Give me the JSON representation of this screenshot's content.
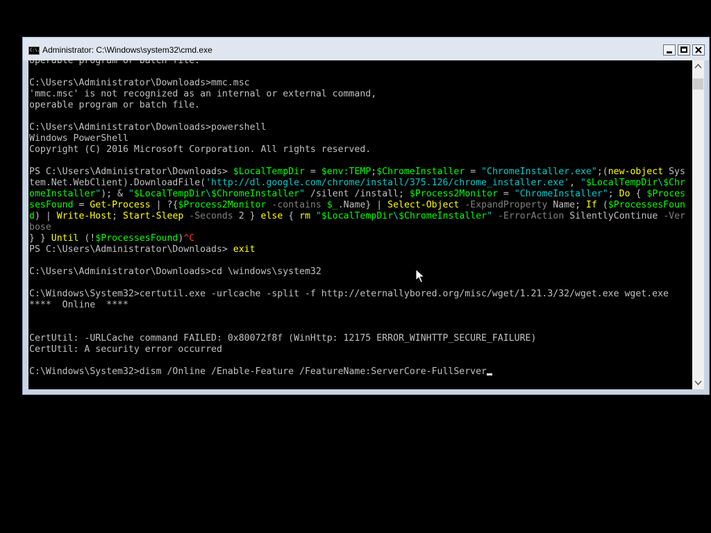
{
  "window": {
    "title": "Administrator: C:\\Windows\\system32\\cmd.exe",
    "icon_text": "C:\\."
  },
  "console": {
    "lines": [
      [
        {
          "t": "operable program or batch file.",
          "c": "default"
        }
      ],
      [],
      [
        {
          "t": "C:\\Users\\Administrator\\Downloads>mmc.msc",
          "c": "default"
        }
      ],
      [
        {
          "t": "'mmc.msc' is not recognized as an internal or external command,",
          "c": "default"
        }
      ],
      [
        {
          "t": "operable program or batch file.",
          "c": "default"
        }
      ],
      [],
      [
        {
          "t": "C:\\Users\\Administrator\\Downloads>powershell",
          "c": "default"
        }
      ],
      [
        {
          "t": "Windows PowerShell",
          "c": "default"
        }
      ],
      [
        {
          "t": "Copyright (C) 2016 Microsoft Corporation. All rights reserved.",
          "c": "default"
        }
      ],
      [],
      [
        {
          "t": "PS C:\\Users\\Administrator\\Downloads> ",
          "c": "default"
        },
        {
          "t": "$LocalTempDir",
          "c": "var"
        },
        {
          "t": " = ",
          "c": "op"
        },
        {
          "t": "$env:TEMP",
          "c": "var"
        },
        {
          "t": ";",
          "c": "op"
        },
        {
          "t": "$ChromeInstaller",
          "c": "var"
        },
        {
          "t": " = ",
          "c": "op"
        },
        {
          "t": "\"ChromeInstaller.exe\"",
          "c": "str"
        },
        {
          "t": ";(",
          "c": "op"
        },
        {
          "t": "new-object",
          "c": "kw"
        },
        {
          "t": " Sys",
          "c": "default"
        }
      ],
      [
        {
          "t": "tem.Net.WebClient).",
          "c": "default"
        },
        {
          "t": "DownloadFile(",
          "c": "default"
        },
        {
          "t": "'http://dl.google.com/chrome/install/375.126/chrome_installer.exe'",
          "c": "str"
        },
        {
          "t": ", ",
          "c": "op"
        },
        {
          "t": "\"",
          "c": "str"
        },
        {
          "t": "$LocalTempDir",
          "c": "var"
        },
        {
          "t": "\\",
          "c": "str"
        },
        {
          "t": "$Chr",
          "c": "var"
        }
      ],
      [
        {
          "t": "omeInstaller",
          "c": "var"
        },
        {
          "t": "\"",
          "c": "str"
        },
        {
          "t": "); & ",
          "c": "op"
        },
        {
          "t": "\"",
          "c": "str"
        },
        {
          "t": "$LocalTempDir",
          "c": "var"
        },
        {
          "t": "\\",
          "c": "str"
        },
        {
          "t": "$ChromeInstaller",
          "c": "var"
        },
        {
          "t": "\"",
          "c": "str"
        },
        {
          "t": " /silent /install; ",
          "c": "default"
        },
        {
          "t": "$Process2Monitor",
          "c": "var"
        },
        {
          "t": " = ",
          "c": "op"
        },
        {
          "t": "\"ChromeInstaller\"",
          "c": "str"
        },
        {
          "t": "; ",
          "c": "op"
        },
        {
          "t": "Do",
          "c": "kw"
        },
        {
          "t": " { ",
          "c": "op"
        },
        {
          "t": "$Proces",
          "c": "var"
        }
      ],
      [
        {
          "t": "sesFound",
          "c": "var"
        },
        {
          "t": " = ",
          "c": "op"
        },
        {
          "t": "Get-Process",
          "c": "kw"
        },
        {
          "t": " | ?{",
          "c": "op"
        },
        {
          "t": "$Process2Monitor",
          "c": "var"
        },
        {
          "t": " -contains ",
          "c": "param"
        },
        {
          "t": "$_",
          "c": "var"
        },
        {
          "t": ".Name} | ",
          "c": "op"
        },
        {
          "t": "Select-Object",
          "c": "kw"
        },
        {
          "t": " -ExpandProperty",
          "c": "param"
        },
        {
          "t": " Name; ",
          "c": "default"
        },
        {
          "t": "If",
          "c": "kw"
        },
        {
          "t": " (",
          "c": "op"
        },
        {
          "t": "$ProcessesFoun",
          "c": "var"
        }
      ],
      [
        {
          "t": "d",
          "c": "var"
        },
        {
          "t": ") | ",
          "c": "op"
        },
        {
          "t": "Write-Host",
          "c": "kw"
        },
        {
          "t": "; ",
          "c": "op"
        },
        {
          "t": "Start-Sleep",
          "c": "kw"
        },
        {
          "t": " -Seconds",
          "c": "param"
        },
        {
          "t": " 2 } ",
          "c": "op"
        },
        {
          "t": "else",
          "c": "kw"
        },
        {
          "t": " { ",
          "c": "op"
        },
        {
          "t": "rm",
          "c": "kw"
        },
        {
          "t": " ",
          "c": "op"
        },
        {
          "t": "\"",
          "c": "str"
        },
        {
          "t": "$LocalTempDir",
          "c": "var"
        },
        {
          "t": "\\",
          "c": "str"
        },
        {
          "t": "$ChromeInstaller",
          "c": "var"
        },
        {
          "t": "\"",
          "c": "str"
        },
        {
          "t": " -ErrorAction",
          "c": "param"
        },
        {
          "t": " SilentlyContinue ",
          "c": "default"
        },
        {
          "t": "-Ver",
          "c": "param"
        }
      ],
      [
        {
          "t": "bose",
          "c": "param"
        }
      ],
      [
        {
          "t": "} } ",
          "c": "op"
        },
        {
          "t": "Until",
          "c": "kw"
        },
        {
          "t": " (!",
          "c": "op"
        },
        {
          "t": "$ProcessesFound",
          "c": "var"
        },
        {
          "t": ")",
          "c": "op"
        },
        {
          "t": "^C",
          "c": "err"
        }
      ],
      [
        {
          "t": "PS C:\\Users\\Administrator\\Downloads> ",
          "c": "default"
        },
        {
          "t": "exit",
          "c": "kw"
        }
      ],
      [],
      [
        {
          "t": "C:\\Users\\Administrator\\Downloads>cd \\windows\\system32",
          "c": "default"
        }
      ],
      [],
      [
        {
          "t": "C:\\Windows\\System32>certutil.exe -urlcache -split -f http://eternallybored.org/misc/wget/1.21.3/32/wget.exe wget.exe",
          "c": "default"
        }
      ],
      [
        {
          "t": "****  Online  ****",
          "c": "default"
        }
      ],
      [],
      [],
      [
        {
          "t": "CertUtil: -URLCache command FAILED: 0x80072f8f (WinHttp: 12175 ERROR_WINHTTP_SECURE_FAILURE)",
          "c": "default"
        }
      ],
      [
        {
          "t": "CertUtil: A security error occurred",
          "c": "default"
        }
      ],
      [],
      [
        {
          "t": "C:\\Windows\\System32>dism /Online /Enable-Feature /FeatureName:ServerCore-FullServer",
          "c": "default"
        }
      ]
    ]
  },
  "icons": {
    "app": "cmd-icon",
    "minimize": "minimize-icon",
    "maximize": "maximize-icon",
    "close": "close-icon",
    "scroll_up": "chevron-up-icon",
    "scroll_down": "chevron-down-icon",
    "mouse": "mouse-pointer-icon"
  },
  "colors": {
    "console_bg": "#000000",
    "default_text": "#c0c0c0",
    "variable": "#00ff00",
    "string": "#00cccc",
    "parameter": "#808080",
    "keyword": "#ffff00",
    "error": "#ff3030"
  }
}
